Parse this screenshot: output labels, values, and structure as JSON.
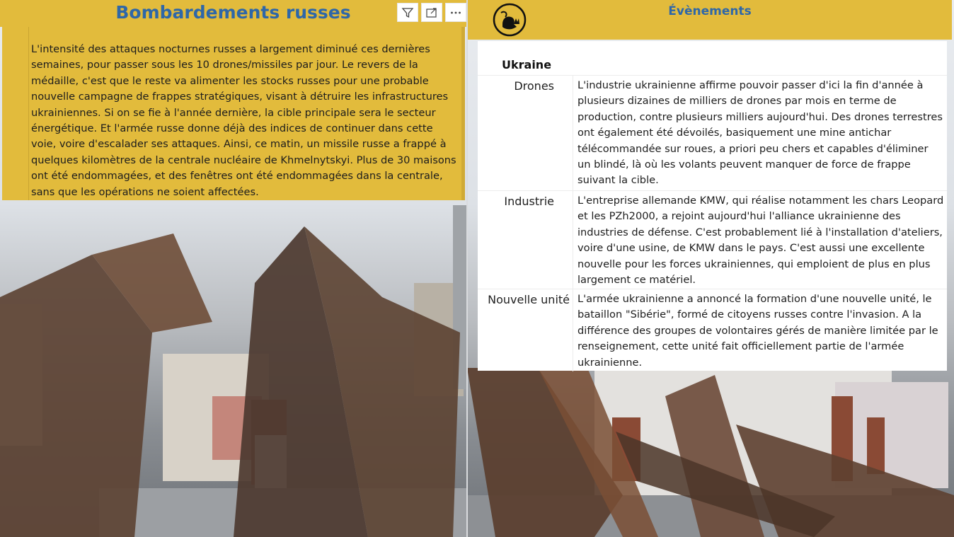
{
  "left_panel": {
    "title": "Bombardements russes",
    "toolbar": {
      "filter_icon": "filter-icon",
      "focus_icon": "focus-mode-icon",
      "more_icon": "more-options-icon"
    },
    "body_text": "L'intensité des attaques nocturnes russes a largement diminué ces dernières semaines, pour passer sous les 10 drones/missiles par jour. Le revers de la médaille, c'est que le reste va alimenter les stocks russes pour une probable nouvelle campagne de frappes stratégiques, visant à détruire les infrastructures ukrainiennes. Si on se fie à l'année dernière, la cible principale sera le secteur énergétique. Et l'armée russe donne déjà des indices de continuer dans cette voie, voire d'escalader ses attaques. Ainsi, ce matin, un missile russe a frappé à quelques kilomètres de la centrale nucléaire de Khmelnytskyi. Plus de 30 maisons ont été endommagées, et des fenêtres ont été endommagées dans la centrale, sans que les opérations ne soient affectées."
  },
  "right_panel": {
    "title": "Évènements",
    "logo_icon": "cat-logo-icon",
    "table": {
      "group_header": "Ukraine",
      "rows": [
        {
          "label": "Drones",
          "text": "L'industrie ukrainienne affirme pouvoir passer d'ici la fin d'année à plusieurs dizaines de milliers de drones par mois en terme de production, contre plusieurs milliers aujourd'hui. Des drones terrestres ont également été dévoilés, basiquement une mine antichar télécommandée sur roues, a priori peu chers et capables d'éliminer un blindé, là où les volants peuvent manquer de force de frappe suivant la cible."
        },
        {
          "label": "Industrie",
          "text": "L'entreprise allemande KMW, qui réalise notamment les chars Leopard et les PZh2000, a rejoint aujourd'hui l'alliance ukrainienne des industries de défense. C'est probablement lié à l'installation d'ateliers, voire d'une usine, de KMW dans le pays. C'est aussi une excellente nouvelle pour les forces ukrainiennes, qui emploient de plus en plus largement ce matériel."
        },
        {
          "label": "Nouvelle unité",
          "text": "L'armée ukrainienne a annoncé la formation d'une nouvelle unité, le bataillon \"Sibérie\", formé de citoyens russes contre l'invasion. A la différence des groupes de volontaires gérés de manière limitée par le renseignement, cette unité fait officiellement partie de l'armée ukrainienne."
        }
      ]
    }
  },
  "colors": {
    "accent_yellow": "#e2bb3c",
    "title_blue": "#2e67a8"
  }
}
